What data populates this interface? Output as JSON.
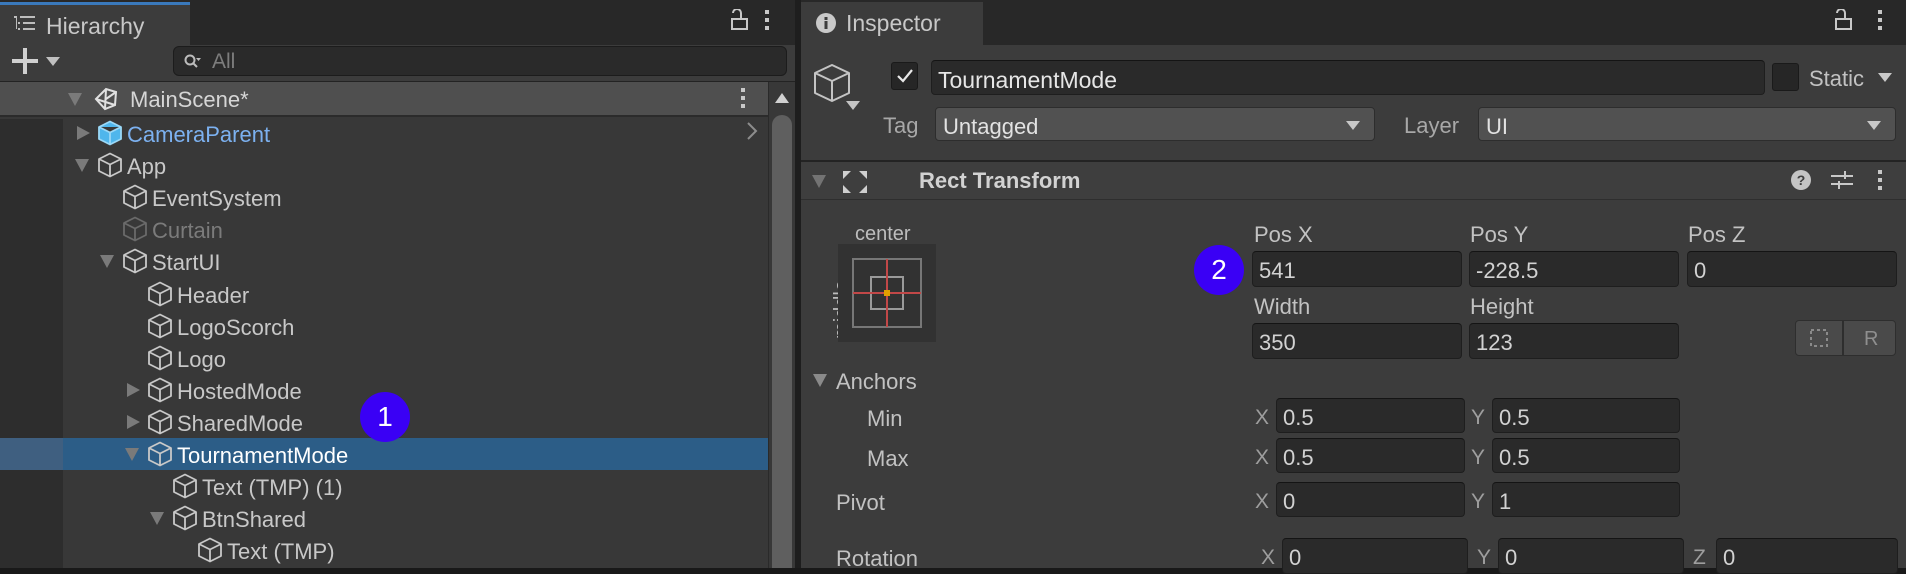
{
  "hierarchy": {
    "tab_label": "Hierarchy",
    "search_placeholder": "All",
    "scene": {
      "name": "MainScene*"
    },
    "items": [
      {
        "label": "CameraParent",
        "depth": 1,
        "expander": "collapsed",
        "kind": "prefab"
      },
      {
        "label": "App",
        "depth": 1,
        "expander": "expanded",
        "kind": "normal"
      },
      {
        "label": "EventSystem",
        "depth": 2,
        "expander": "none",
        "kind": "normal"
      },
      {
        "label": "Curtain",
        "depth": 2,
        "expander": "none",
        "kind": "inactive"
      },
      {
        "label": "StartUI",
        "depth": 2,
        "expander": "expanded",
        "kind": "normal"
      },
      {
        "label": "Header",
        "depth": 3,
        "expander": "none",
        "kind": "normal"
      },
      {
        "label": "LogoScorch",
        "depth": 3,
        "expander": "none",
        "kind": "normal"
      },
      {
        "label": "Logo",
        "depth": 3,
        "expander": "none",
        "kind": "normal"
      },
      {
        "label": "HostedMode",
        "depth": 3,
        "expander": "collapsed",
        "kind": "normal"
      },
      {
        "label": "SharedMode",
        "depth": 3,
        "expander": "collapsed",
        "kind": "normal"
      },
      {
        "label": "TournamentMode",
        "depth": 3,
        "expander": "expanded",
        "kind": "selected"
      },
      {
        "label": "Text (TMP) (1)",
        "depth": 4,
        "expander": "none",
        "kind": "normal"
      },
      {
        "label": "BtnShared",
        "depth": 4,
        "expander": "expanded",
        "kind": "normal"
      },
      {
        "label": "Text (TMP)",
        "depth": 5,
        "expander": "none",
        "kind": "normal"
      }
    ]
  },
  "inspector": {
    "tab_label": "Inspector",
    "object": {
      "active": true,
      "name": "TournamentMode",
      "static_label": "Static",
      "static_checked": false,
      "tag_label": "Tag",
      "tag_value": "Untagged",
      "layer_label": "Layer",
      "layer_value": "UI"
    },
    "rect_transform": {
      "title": "Rect Transform",
      "anchor_preset_h": "center",
      "anchor_preset_v": "middle",
      "pos_x_label": "Pos X",
      "pos_x": "541",
      "pos_y_label": "Pos Y",
      "pos_y": "-228.5",
      "pos_z_label": "Pos Z",
      "pos_z": "0",
      "width_label": "Width",
      "width": "350",
      "height_label": "Height",
      "height": "123",
      "raw_button_label": "R",
      "anchors_label": "Anchors",
      "min_label": "Min",
      "min_x": "0.5",
      "min_y": "0.5",
      "max_label": "Max",
      "max_x": "0.5",
      "max_y": "0.5",
      "pivot_label": "Pivot",
      "pivot_x": "0",
      "pivot_y": "1",
      "rotation_label": "Rotation",
      "rotation_x": "0",
      "rotation_y": "0",
      "rotation_z": "0",
      "axis_x": "X",
      "axis_y": "Y",
      "axis_z": "Z"
    }
  },
  "annotations": {
    "badge_1": "1",
    "badge_2": "2",
    "color": "#3a00f5"
  },
  "colors": {
    "selection": "#2c5d87",
    "prefab_text": "#7cb1f0",
    "anchor_dot": "#e0a000",
    "anchor_cross": "#c24848"
  }
}
